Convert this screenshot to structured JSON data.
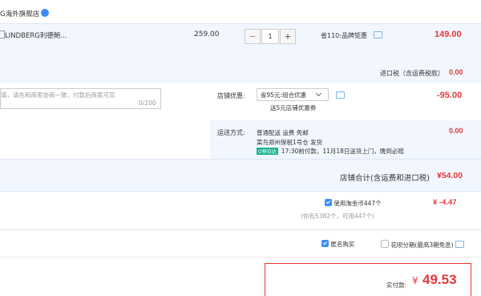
{
  "shop": {
    "name": "G海外旗舰店"
  },
  "item": {
    "title": "LINDBERG利德鲍",
    "price": "259.00",
    "quantity": "1",
    "promo": "省110:品牌钜惠",
    "subtotal": "149.00"
  },
  "import_tax": {
    "label": "进口税（含运费税款）",
    "value": "0.00"
  },
  "message": {
    "placeholder": "填，请先和商家协商一致，付款后商家可见",
    "counter": "0/200"
  },
  "store_discount": {
    "label": "店铺优惠:",
    "selected": "省95元:组合优惠",
    "sub": "送5元店铺优惠券",
    "value": "-95.00"
  },
  "shipping": {
    "label": "运送方式:",
    "line1": "普通配送 运费 免邮",
    "line2": "菜鸟郑州保税1号仓  发货",
    "badge": "O预日达",
    "line3": "17:30前付款，11月18日送货上门，晚到必赔",
    "value": "0.00"
  },
  "store_total": {
    "label": "店铺合计(含运费和进口税)",
    "value": "¥54.00"
  },
  "coins": {
    "label": "使用淘金币447个",
    "sub": "(你有5382个，可用447个)",
    "value": "¥ -4.47"
  },
  "options": {
    "anonymous": "匿名购买",
    "huabei": "花呗分期(最高3期免息)"
  },
  "payment": {
    "label": "实付款:",
    "currency": "¥",
    "amount": "49.53"
  },
  "colors": {
    "accent": "#e4393c",
    "band": "#f2f7ff",
    "brand_blue": "#3c8ef5"
  }
}
